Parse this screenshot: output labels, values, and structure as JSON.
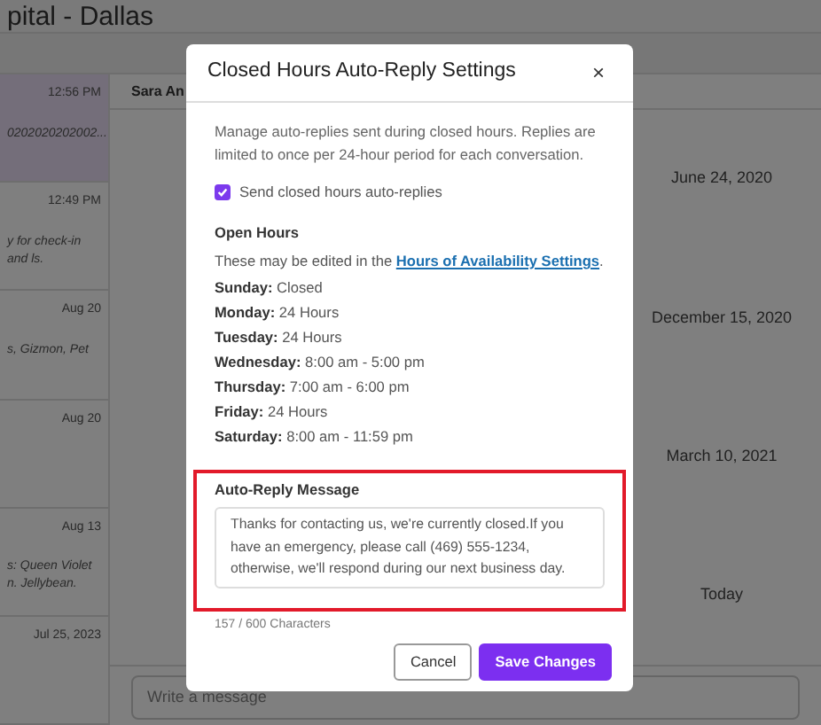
{
  "app": {
    "title": "pital - Dallas",
    "conversations": [
      {
        "time": "12:56 PM",
        "preview": "0202020202002...",
        "selected": true
      },
      {
        "time": "12:49 PM",
        "preview": "y for check-in and ls.",
        "selected": false
      },
      {
        "time": "Aug 20",
        "preview": "s, Gizmon, Pet",
        "selected": false
      },
      {
        "time": "Aug 20",
        "selected": false
      },
      {
        "time": "Aug 13",
        "preview": "s: Queen Violet n. Jellybean.",
        "selected": false
      },
      {
        "time": "Jul 25, 2023",
        "selected": false
      }
    ],
    "chat": {
      "contact": "Sara An",
      "dates": [
        "June 24, 2020",
        "December 15, 2020",
        "March 10, 2021",
        "Today"
      ],
      "composer": {
        "placeholder": "Write a message"
      }
    }
  },
  "dialog": {
    "title": "Closed Hours Auto-Reply Settings",
    "close": "×",
    "description": "Manage auto-replies sent during closed hours. Replies are limited to once per 24-hour period for each conversation.",
    "send_toggle": {
      "label": "Send closed hours auto-replies",
      "checked": true
    },
    "open_hours": {
      "heading": "Open Hours",
      "note": "These may be edited in the",
      "link": "Hours of Availability Settings",
      "note_end": ".",
      "days": [
        {
          "day": "Sunday:",
          "hours": "Closed"
        },
        {
          "day": "Monday:",
          "hours": "24 Hours"
        },
        {
          "day": "Tuesday:",
          "hours": "24 Hours"
        },
        {
          "day": "Wednesday:",
          "hours": "8:00 am - 5:00 pm"
        },
        {
          "day": "Thursday:",
          "hours": "7:00 am - 6:00 pm"
        },
        {
          "day": "Friday:",
          "hours": "24 Hours"
        },
        {
          "day": "Saturday:",
          "hours": "8:00 am - 11:59 pm"
        }
      ]
    },
    "message": {
      "label": "Auto-Reply Message",
      "value": "Thanks for contacting us, we're currently closed.If you have an emergency, please call (469) 555-1234, otherwise, we'll respond during our next business day.",
      "count": "157 / 600 Characters"
    },
    "buttons": [
      {
        "label": "Cancel",
        "kind": "secondary"
      },
      {
        "label": "Save Changes",
        "kind": "primary"
      }
    ]
  }
}
